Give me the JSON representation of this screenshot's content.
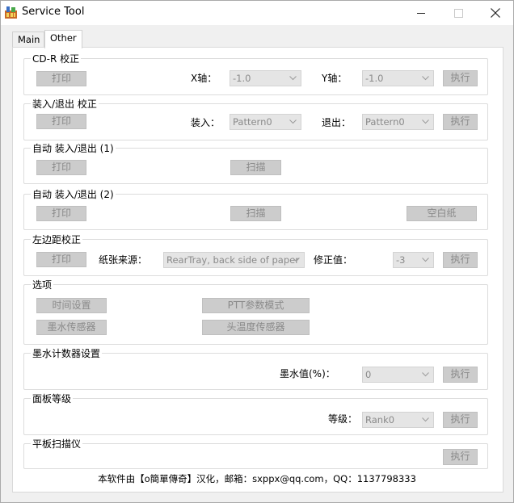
{
  "window": {
    "title": "Service Tool"
  },
  "tabs": [
    {
      "label": "Main"
    },
    {
      "label": "Other"
    }
  ],
  "cdr": {
    "title": "CD-R 校正",
    "print": "打印",
    "x_label": "X轴：",
    "x_value": "-1.0",
    "y_label": "Y轴：",
    "y_value": "-1.0",
    "execute": "执行"
  },
  "loadeject": {
    "title": "装入/退出 校正",
    "print": "打印",
    "load_label": "装入：",
    "load_value": "Pattern0",
    "eject_label": "退出：",
    "eject_value": "Pattern0",
    "execute": "执行"
  },
  "auto1": {
    "title": "自动 装入/退出 (1)",
    "print": "打印",
    "scan": "扫描"
  },
  "auto2": {
    "title": "自动 装入/退出 (2)",
    "print": "打印",
    "scan": "扫描",
    "blank": "空白纸"
  },
  "leftmargin": {
    "title": "左边距校正",
    "print": "打印",
    "source_label": "纸张来源：",
    "source_value": "RearTray, back side of paper",
    "correction_label": "修正值：",
    "correction_value": "-3",
    "execute": "执行"
  },
  "options": {
    "title": "选项",
    "time": "时间设置",
    "ptt": "PTT参数模式",
    "ink_sensor": "墨水传感器",
    "head_temp": "头温度传感器"
  },
  "inkcounter": {
    "title": "墨水计数器设置",
    "value_label": "墨水值(%)：",
    "value": "0",
    "execute": "执行"
  },
  "panel": {
    "title": "面板等级",
    "rank_label": "等级：",
    "rank_value": "Rank0",
    "execute": "执行"
  },
  "flatbed": {
    "title": "平板扫描仪",
    "execute": "执行"
  },
  "footer": {
    "text": "本软件由【o簡單傳奇】汉化，邮箱：sxppx@qq.com，QQ：1137798333"
  },
  "icons": {
    "app": "app-icon",
    "minimize": "minimize-icon",
    "maximize": "maximize-icon",
    "close": "close-icon",
    "dropdown": "chevron-down-icon"
  }
}
